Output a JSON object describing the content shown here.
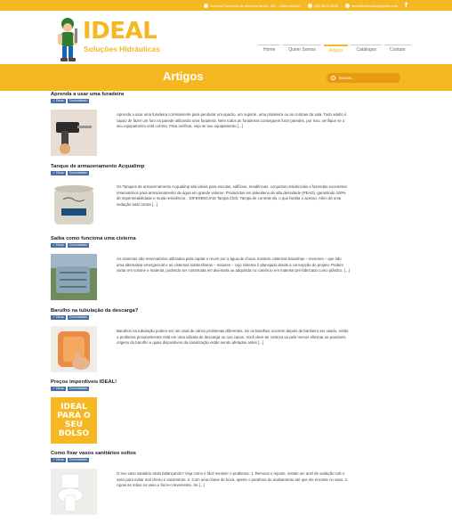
{
  "topbar": {
    "address": "Avenida Tancredo de Almeida Neves, 331 - Gatemas/MG",
    "phone": "(35) 3622-3602",
    "email": "ideal@hidraulica@gmail.com",
    "facebook": "f"
  },
  "brand": {
    "name": "IDEAL",
    "tagline": "Soluções Hidráulicas",
    "color": "#f5b823"
  },
  "nav": [
    {
      "label": "Home",
      "active": false
    },
    {
      "label": "Quem Somos",
      "active": false
    },
    {
      "label": "Artigos",
      "active": true
    },
    {
      "label": "Catálogos",
      "active": false
    },
    {
      "label": "Contato",
      "active": false
    }
  ],
  "banner": {
    "title": "Artigos",
    "search_placeholder": "Buscar..."
  },
  "posts": [
    {
      "title": "Aprenda a usar uma furadeira",
      "tags": [
        "Dicas",
        "Curiosidades"
      ],
      "thumb": "drill-photo",
      "excerpt": "Aprenda a usar uma furadeira corretamente para pendurar um quadro, um suporte, uma prateleira ou as cortinas da sala. Todo adulto é capaz de fazer um furo na parede utilizando uma furadeira. Nem todos as furadeiras conseguem furar paredes, por isso, verifique se o seu equipamento está correto. Para verificar, veja se seu equipamento [...]"
    },
    {
      "title": "Tanque de armazenamento Acqualimp",
      "tags": [
        "Dicas",
        "Curiosidades"
      ],
      "thumb": "tank-photo",
      "excerpt": "Os Tanques de armazenamento Acqualimp são ideais para escolas, edifícios, residências, conjuntos residenciais e fazendas excelentes reservatórios para armazenamento de água em grande volume. Produzidos em polietileno de alta densidade (PEAD), garantindo 100% de impermeabilidade e muita resistência. . DIFERENCIAIS Tampa Click: Tampa de controle da, o que facilita o acesso; Além de uma vedação total contra [...]"
    },
    {
      "title": "Saiba como funciona uma cisterna",
      "tags": [
        "Dicas",
        "Curiosidades"
      ],
      "thumb": "cistern-photo",
      "excerpt": "As cisternas são reservatórios utilizados para captar e reunir por a água de chuva. Existem cisternas baixinhas – menores – que são uma alternativa emergencial e as cisternas subterrâneas – maiores – cujo sistema é planejado desde a concepção do projeto. Podem variar em volume e material, podendo ser construída em alvenaria ou adquirida no comércio em material pré-fabricado como plástico, [...]"
    },
    {
      "title": "Barulho na tubulação da descarga?",
      "tags": [
        "Dicas",
        "Curiosidades"
      ],
      "thumb": "flush-button-photo",
      "excerpt": "Barulhos na tubulação podem ser um sinal de vários problemas diferentes. Se os barulhos ocorrem depois de banheiro ser usado, então o problema provavelmente está em uma válvula de descarga ou nos canos. Você deve ter certeza ou pelo menos eliminar as possíveis origens do barulho e quais dispositivos da canalização estão sendo afetados antes [...]"
    },
    {
      "title": "Preços imperdíveis IDEAL!",
      "tags": [
        "Dicas",
        "Curiosidades"
      ],
      "thumb": "promo-photo",
      "thumb_text": "IDEAL PARA O SEU BOLSO",
      "excerpt": ""
    },
    {
      "title": "Como fixar vasos sanitários soltos",
      "tags": [
        "Dicas",
        "Curiosidades"
      ],
      "thumb": "toilet-photo",
      "excerpt": "O seu vaso sanitário anda balançando? Veja como é fácil resolver o problema: 1. Remova o rejunte, instale um anel de vedação sob o vaso para evitar mal cheiro e vazamento. 2. Com uma chave de boca, aperte o parafuso do acabamento até que ele encoste no vaso. 3. Apoie as mãos no vaso e force-o levemente. Se [...]"
    }
  ]
}
